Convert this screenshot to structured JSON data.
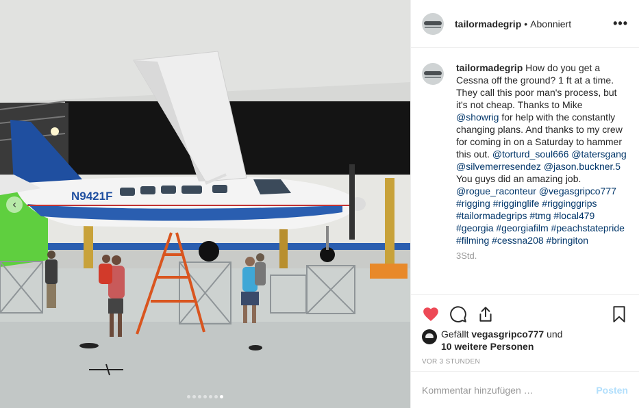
{
  "post": {
    "author": "tailormadegrip",
    "follow_status": "Abonniert",
    "separator": "•",
    "more_icon": "more-horizontal-icon",
    "caption_parts": [
      {
        "text": "How do you get a Cessna off the ground? 1 ft at a time. They call this poor man's process, but it's not cheap. Thanks to Mike ",
        "link": false
      },
      {
        "text": "@showrig",
        "link": true
      },
      {
        "text": " for help with the constantly changing plans. And thanks to my crew for coming in on a Saturday to hammer this out. ",
        "link": false
      },
      {
        "text": "@torturd_soul666",
        "link": true
      },
      {
        "text": " ",
        "link": false
      },
      {
        "text": "@tatersgang",
        "link": true
      },
      {
        "text": " ",
        "link": false
      },
      {
        "text": "@silvemerresendez",
        "link": true
      },
      {
        "text": " ",
        "link": false
      },
      {
        "text": "@jason.buckner.5",
        "link": true
      },
      {
        "text": " You guys did an amazing job. ",
        "link": false
      },
      {
        "text": "@rogue_raconteur",
        "link": true
      },
      {
        "text": " ",
        "link": false
      },
      {
        "text": "@vegasgripco777",
        "link": true
      },
      {
        "text": " ",
        "link": false
      },
      {
        "text": "#rigging",
        "link": true
      },
      {
        "text": " ",
        "link": false
      },
      {
        "text": "#rigginglife",
        "link": true
      },
      {
        "text": " ",
        "link": false
      },
      {
        "text": "#rigginggrips",
        "link": true
      },
      {
        "text": " ",
        "link": false
      },
      {
        "text": "#tailormadegrips",
        "link": true
      },
      {
        "text": " ",
        "link": false
      },
      {
        "text": "#tmg",
        "link": true
      },
      {
        "text": " ",
        "link": false
      },
      {
        "text": "#local479",
        "link": true
      },
      {
        "text": " ",
        "link": false
      },
      {
        "text": "#georgia",
        "link": true
      },
      {
        "text": " ",
        "link": false
      },
      {
        "text": "#georgiafilm",
        "link": true
      },
      {
        "text": " ",
        "link": false
      },
      {
        "text": "#peachstatepride",
        "link": true
      },
      {
        "text": " ",
        "link": false
      },
      {
        "text": "#filming",
        "link": true
      },
      {
        "text": " ",
        "link": false
      },
      {
        "text": "#cessna208",
        "link": true
      },
      {
        "text": " ",
        "link": false
      },
      {
        "text": "#bringiton",
        "link": true
      }
    ],
    "caption_time": "3Std.",
    "likes_prefix": "Gefällt",
    "liked_by": "vegasgripco777",
    "likes_and": "und",
    "likes_others": "10 weitere Personen",
    "time_ago": "VOR 3 STUNDEN",
    "comment_placeholder": "Kommentar hinzufügen …",
    "post_label": "Posten"
  },
  "image": {
    "aircraft_registration": "N9421F",
    "carousel": {
      "count": 7,
      "active_index": 6
    }
  },
  "colors": {
    "like_red": "#ed4956",
    "link_blue": "#003569",
    "post_disabled": "#b2dffc",
    "plane_blue": "#1f4fa0"
  },
  "icons": [
    "heart-icon",
    "comment-icon",
    "share-icon",
    "bookmark-icon",
    "chevron-left-icon"
  ]
}
